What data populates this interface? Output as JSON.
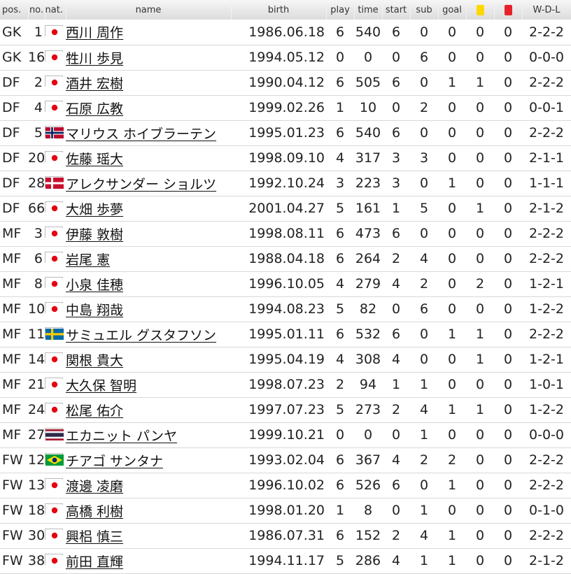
{
  "headers": {
    "pos": "pos.",
    "no": "no.",
    "nat": "nat.",
    "name": "name",
    "birth": "birth",
    "play": "play",
    "time": "time",
    "start": "start",
    "sub": "sub",
    "goal": "goal",
    "wdl": "W-D-L"
  },
  "colors": {
    "yellow_card": "#ffd700",
    "red_card": "#e8222a"
  },
  "players": [
    {
      "pos": "GK",
      "no": "1",
      "flag": "japan",
      "name": "西川 周作",
      "birth": "1986.06.18",
      "play": "6",
      "time": "540",
      "start": "6",
      "sub": "0",
      "goal": "0",
      "yellow": "0",
      "red": "0",
      "wdl": "2-2-2"
    },
    {
      "pos": "GK",
      "no": "16",
      "flag": "japan",
      "name": "牲川 歩見",
      "birth": "1994.05.12",
      "play": "0",
      "time": "0",
      "start": "0",
      "sub": "6",
      "goal": "0",
      "yellow": "0",
      "red": "0",
      "wdl": "0-0-0"
    },
    {
      "pos": "DF",
      "no": "2",
      "flag": "japan",
      "name": "酒井 宏樹",
      "birth": "1990.04.12",
      "play": "6",
      "time": "505",
      "start": "6",
      "sub": "0",
      "goal": "1",
      "yellow": "1",
      "red": "0",
      "wdl": "2-2-2"
    },
    {
      "pos": "DF",
      "no": "4",
      "flag": "japan",
      "name": "石原 広教",
      "birth": "1999.02.26",
      "play": "1",
      "time": "10",
      "start": "0",
      "sub": "2",
      "goal": "0",
      "yellow": "0",
      "red": "0",
      "wdl": "0-0-1"
    },
    {
      "pos": "DF",
      "no": "5",
      "flag": "norway",
      "name": "マリウス ホイブラーテン",
      "birth": "1995.01.23",
      "play": "6",
      "time": "540",
      "start": "6",
      "sub": "0",
      "goal": "0",
      "yellow": "0",
      "red": "0",
      "wdl": "2-2-2"
    },
    {
      "pos": "DF",
      "no": "20",
      "flag": "japan",
      "name": "佐藤 瑶大",
      "birth": "1998.09.10",
      "play": "4",
      "time": "317",
      "start": "3",
      "sub": "3",
      "goal": "0",
      "yellow": "0",
      "red": "0",
      "wdl": "2-1-1"
    },
    {
      "pos": "DF",
      "no": "28",
      "flag": "denmark",
      "name": "アレクサンダー ショルツ",
      "birth": "1992.10.24",
      "play": "3",
      "time": "223",
      "start": "3",
      "sub": "0",
      "goal": "1",
      "yellow": "0",
      "red": "0",
      "wdl": "1-1-1"
    },
    {
      "pos": "DF",
      "no": "66",
      "flag": "japan",
      "name": "大畑 歩夢",
      "birth": "2001.04.27",
      "play": "5",
      "time": "161",
      "start": "1",
      "sub": "5",
      "goal": "0",
      "yellow": "1",
      "red": "0",
      "wdl": "2-1-2"
    },
    {
      "pos": "MF",
      "no": "3",
      "flag": "japan",
      "name": "伊藤 敦樹",
      "birth": "1998.08.11",
      "play": "6",
      "time": "473",
      "start": "6",
      "sub": "0",
      "goal": "0",
      "yellow": "0",
      "red": "0",
      "wdl": "2-2-2"
    },
    {
      "pos": "MF",
      "no": "6",
      "flag": "japan",
      "name": "岩尾 憲",
      "birth": "1988.04.18",
      "play": "6",
      "time": "264",
      "start": "2",
      "sub": "4",
      "goal": "0",
      "yellow": "0",
      "red": "0",
      "wdl": "2-2-2"
    },
    {
      "pos": "MF",
      "no": "8",
      "flag": "japan",
      "name": "小泉 佳穂",
      "birth": "1996.10.05",
      "play": "4",
      "time": "279",
      "start": "4",
      "sub": "2",
      "goal": "0",
      "yellow": "2",
      "red": "0",
      "wdl": "1-2-1"
    },
    {
      "pos": "MF",
      "no": "10",
      "flag": "japan",
      "name": "中島 翔哉",
      "birth": "1994.08.23",
      "play": "5",
      "time": "82",
      "start": "0",
      "sub": "6",
      "goal": "0",
      "yellow": "0",
      "red": "0",
      "wdl": "1-2-2"
    },
    {
      "pos": "MF",
      "no": "11",
      "flag": "sweden",
      "name": "サミュエル グスタフソン",
      "birth": "1995.01.11",
      "play": "6",
      "time": "532",
      "start": "6",
      "sub": "0",
      "goal": "1",
      "yellow": "1",
      "red": "0",
      "wdl": "2-2-2"
    },
    {
      "pos": "MF",
      "no": "14",
      "flag": "japan",
      "name": "関根 貴大",
      "birth": "1995.04.19",
      "play": "4",
      "time": "308",
      "start": "4",
      "sub": "0",
      "goal": "0",
      "yellow": "1",
      "red": "0",
      "wdl": "1-2-1"
    },
    {
      "pos": "MF",
      "no": "21",
      "flag": "japan",
      "name": "大久保 智明",
      "birth": "1998.07.23",
      "play": "2",
      "time": "94",
      "start": "1",
      "sub": "1",
      "goal": "0",
      "yellow": "0",
      "red": "0",
      "wdl": "1-0-1"
    },
    {
      "pos": "MF",
      "no": "24",
      "flag": "japan",
      "name": "松尾 佑介",
      "birth": "1997.07.23",
      "play": "5",
      "time": "273",
      "start": "2",
      "sub": "4",
      "goal": "1",
      "yellow": "1",
      "red": "0",
      "wdl": "1-2-2"
    },
    {
      "pos": "MF",
      "no": "27",
      "flag": "thailand",
      "name": "エカニット パンヤ",
      "birth": "1999.10.21",
      "play": "0",
      "time": "0",
      "start": "0",
      "sub": "1",
      "goal": "0",
      "yellow": "0",
      "red": "0",
      "wdl": "0-0-0"
    },
    {
      "pos": "FW",
      "no": "12",
      "flag": "brazil",
      "name": "チアゴ サンタナ",
      "birth": "1993.02.04",
      "play": "6",
      "time": "367",
      "start": "4",
      "sub": "2",
      "goal": "2",
      "yellow": "0",
      "red": "0",
      "wdl": "2-2-2"
    },
    {
      "pos": "FW",
      "no": "13",
      "flag": "japan",
      "name": "渡邊 凌磨",
      "birth": "1996.10.02",
      "play": "6",
      "time": "526",
      "start": "6",
      "sub": "0",
      "goal": "1",
      "yellow": "0",
      "red": "0",
      "wdl": "2-2-2"
    },
    {
      "pos": "FW",
      "no": "18",
      "flag": "japan",
      "name": "高橋 利樹",
      "birth": "1998.01.20",
      "play": "1",
      "time": "8",
      "start": "0",
      "sub": "1",
      "goal": "0",
      "yellow": "0",
      "red": "0",
      "wdl": "0-1-0"
    },
    {
      "pos": "FW",
      "no": "30",
      "flag": "japan",
      "name": "興梠 慎三",
      "birth": "1986.07.31",
      "play": "6",
      "time": "152",
      "start": "2",
      "sub": "4",
      "goal": "1",
      "yellow": "0",
      "red": "0",
      "wdl": "2-2-2"
    },
    {
      "pos": "FW",
      "no": "38",
      "flag": "japan",
      "name": "前田 直輝",
      "birth": "1994.11.17",
      "play": "5",
      "time": "286",
      "start": "4",
      "sub": "1",
      "goal": "1",
      "yellow": "0",
      "red": "0",
      "wdl": "2-1-2"
    }
  ]
}
